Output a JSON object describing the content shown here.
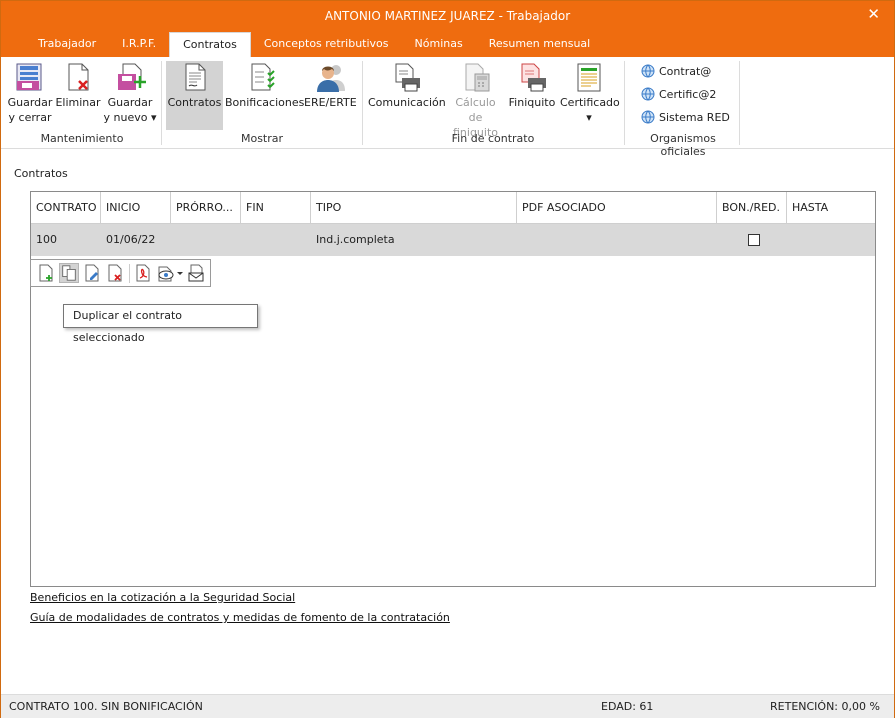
{
  "window": {
    "title": "ANTONIO MARTINEZ JUAREZ - Trabajador",
    "close_glyph": "✕"
  },
  "tabs": [
    {
      "label": "Trabajador",
      "active": false
    },
    {
      "label": "I.R.P.F.",
      "active": false
    },
    {
      "label": "Contratos",
      "active": true
    },
    {
      "label": "Conceptos retributivos",
      "active": false
    },
    {
      "label": "Nóminas",
      "active": false
    },
    {
      "label": "Resumen mensual",
      "active": false
    }
  ],
  "ribbon": {
    "mantenimiento": {
      "group_label": "Mantenimiento",
      "guardar_cerrar": {
        "line1": "Guardar",
        "line2": "y cerrar",
        "icon": "save-close-icon"
      },
      "eliminar": {
        "line1": "Eliminar",
        "icon": "delete-document-icon"
      },
      "guardar_nuevo": {
        "line1": "Guardar",
        "line2": "y nuevo ▾",
        "icon": "save-new-icon"
      }
    },
    "mostrar": {
      "group_label": "Mostrar",
      "contratos": {
        "line1": "Contratos",
        "icon": "contract-document-icon"
      },
      "bonificaciones": {
        "line1": "Bonificaciones",
        "icon": "checklist-icon"
      },
      "ere": {
        "line1": "ERE/ERTE",
        "icon": "person-icon"
      }
    },
    "fin_contrato": {
      "group_label": "Fin de contrato",
      "comunicacion": {
        "line1": "Comunicación",
        "icon": "print-document-icon"
      },
      "calculo": {
        "line1": "Cálculo de",
        "line2": "finiquito",
        "icon": "calculator-icon",
        "disabled": true
      },
      "finiquito": {
        "line1": "Finiquito",
        "icon": "print-red-document-icon"
      },
      "certificado": {
        "line1": "Certificado",
        "line2": "▾",
        "icon": "certificate-icon"
      }
    },
    "organismos": {
      "group_label": "Organismos oficiales",
      "items": [
        {
          "label": "Contrat@",
          "icon": "globe-icon"
        },
        {
          "label": "Certific@2",
          "icon": "globe-icon"
        },
        {
          "label": "Sistema RED",
          "icon": "globe-icon"
        }
      ]
    }
  },
  "section": {
    "label": "Contratos"
  },
  "table": {
    "columns": [
      "CONTRATO",
      "INICIO",
      "PRÓRRO...",
      "FIN",
      "TIPO",
      "PDF ASOCIADO",
      "BON./RED.",
      "HASTA"
    ],
    "rows": [
      {
        "contrato": "100",
        "inicio": "01/06/22",
        "prorroga": "",
        "fin": "",
        "tipo": "Ind.j.completa",
        "pdf": "",
        "bonificado": false,
        "hasta": ""
      }
    ]
  },
  "mini_toolbar": {
    "buttons": [
      "new-document-icon",
      "duplicate-document-icon",
      "edit-document-icon",
      "delete-document-icon",
      "pdf-icon",
      "view-icon",
      "email-icon"
    ]
  },
  "tooltip": {
    "text": "Duplicar el contrato seleccionado"
  },
  "links": {
    "beneficios": "Beneficios en la cotización a la Seguridad Social",
    "guia": "Guía de modalidades de contratos y medidas de fomento de la contratación"
  },
  "status": {
    "left": "CONTRATO 100.  SIN BONIFICACIÓN",
    "edad": "EDAD: 61",
    "retencion": "RETENCIÓN: 0,00 %"
  },
  "colors": {
    "titlebar": "#ef6c0f",
    "selected_row": "#d9d9d9",
    "status_bg": "#ededed"
  }
}
